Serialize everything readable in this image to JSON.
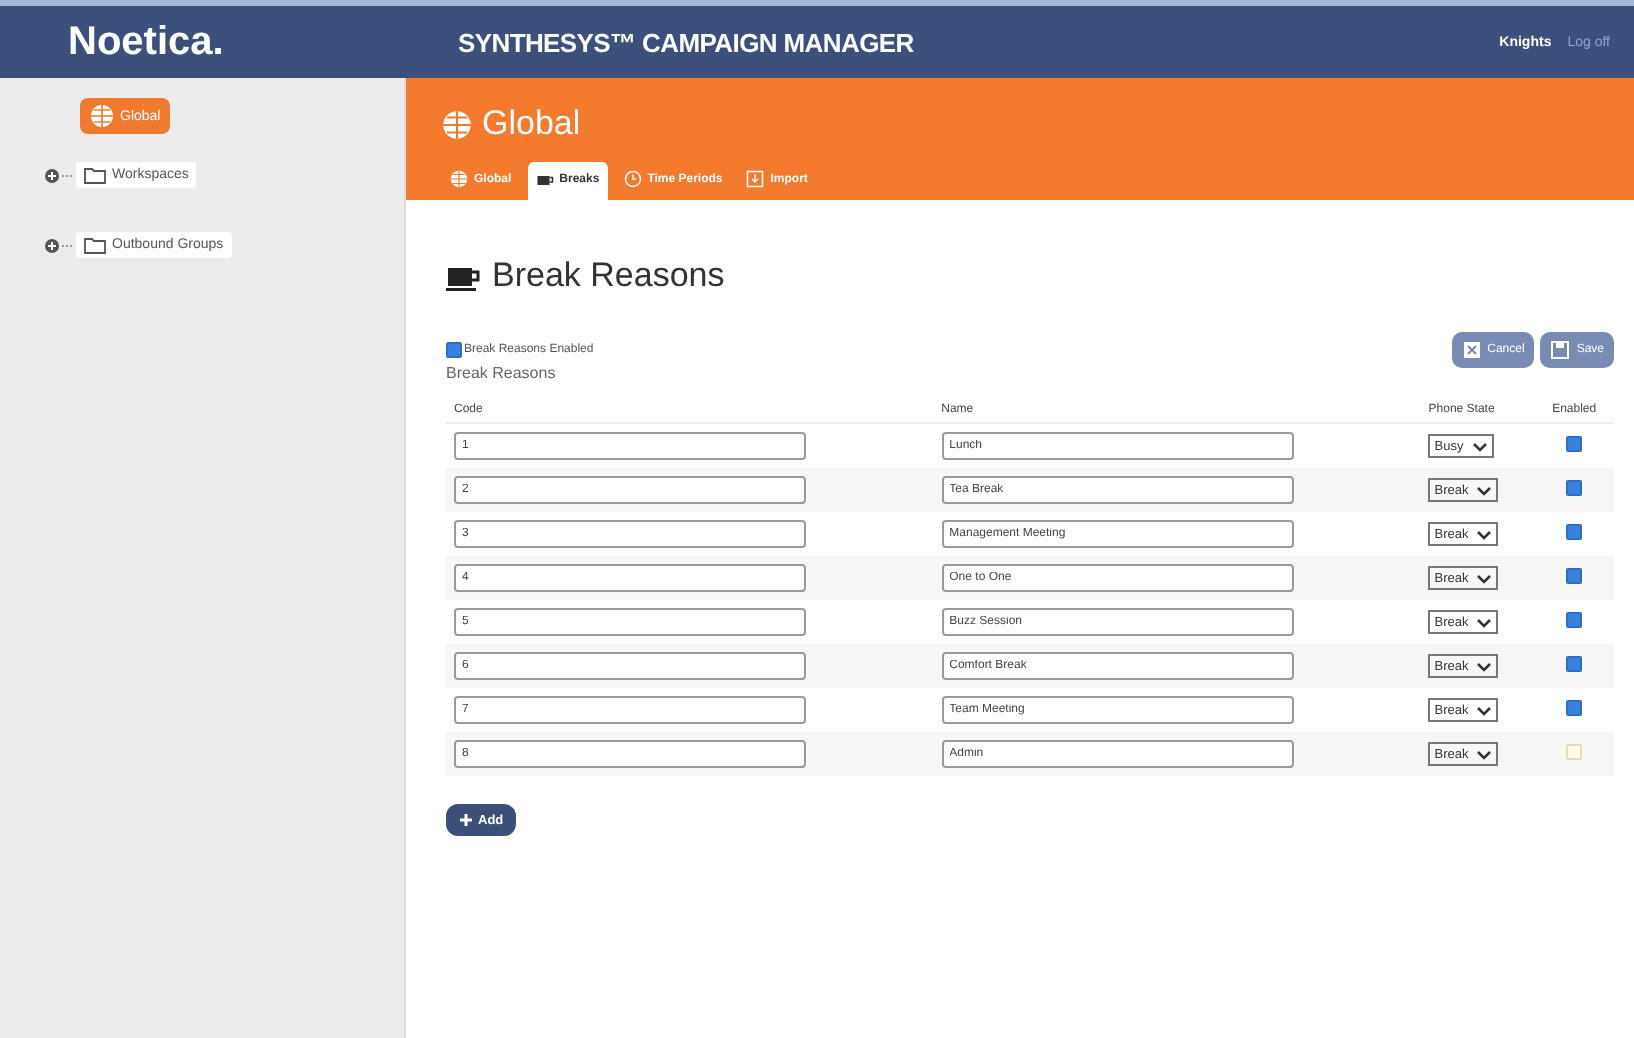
{
  "header": {
    "logo": "Noetica.",
    "title": "SYNTHESYS™ CAMPAIGN MANAGER",
    "user": "Knights",
    "logout": "Log off"
  },
  "sidebar": {
    "button": "Global",
    "items": [
      {
        "label": "Workspaces"
      },
      {
        "label": "Outbound Groups"
      }
    ]
  },
  "panel": {
    "title": "Global",
    "tabs": [
      {
        "label": "Global",
        "selected": false
      },
      {
        "label": "Breaks",
        "selected": true
      },
      {
        "label": "Time Periods",
        "selected": false
      },
      {
        "label": "Import",
        "selected": false
      }
    ]
  },
  "page": {
    "heading": "Break Reasons",
    "enabled_label": "Break Reasons Enabled",
    "enabled": true,
    "section": "Break Reasons",
    "buttons": [
      "Cancel",
      "Save"
    ],
    "add": "Add"
  },
  "table": {
    "columns": [
      "Code",
      "Name",
      "Phone State",
      "Enabled"
    ],
    "rows": [
      {
        "code": "1",
        "name": "Lunch",
        "state": "Busy",
        "enabled": true
      },
      {
        "code": "2",
        "name": "Tea Break",
        "state": "Break",
        "enabled": true
      },
      {
        "code": "3",
        "name": "Management Meeting",
        "state": "Break",
        "enabled": true
      },
      {
        "code": "4",
        "name": "One to One",
        "state": "Break",
        "enabled": true
      },
      {
        "code": "5",
        "name": "Buzz Session",
        "state": "Break",
        "enabled": true
      },
      {
        "code": "6",
        "name": "Comfort Break",
        "state": "Break",
        "enabled": true
      },
      {
        "code": "7",
        "name": "Team Meeting",
        "state": "Break",
        "enabled": true
      },
      {
        "code": "8",
        "name": "Admin",
        "state": "Break",
        "enabled": false
      }
    ]
  }
}
